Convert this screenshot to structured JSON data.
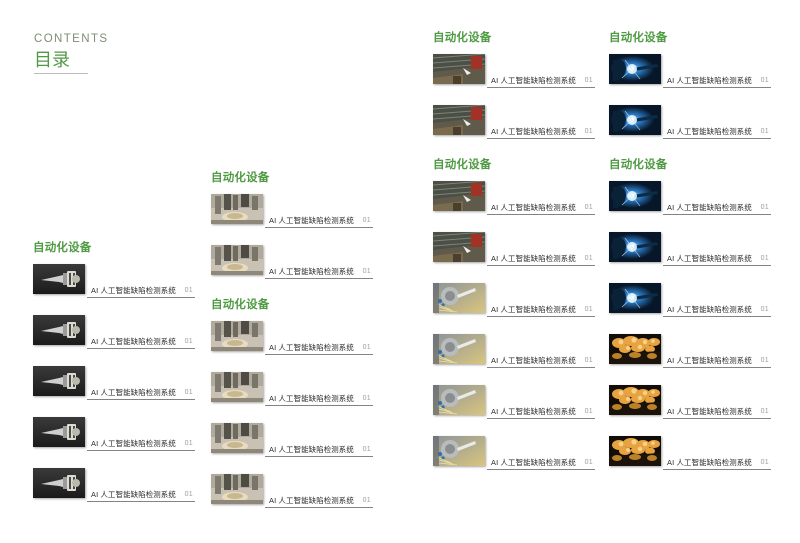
{
  "header": {
    "title_en": "CONTENTS",
    "title_cn": "目录",
    "accent_color": "#4f9a43",
    "title_en_color": "#7d8f75"
  },
  "entry_defaults": {
    "label": "AI 人工智能缺陷检测系统",
    "number": "01"
  },
  "columns": [
    {
      "name": "column-1",
      "sections": [
        {
          "title": "自动化设备",
          "thumb": "spindle",
          "items": [
            {
              "label": "AI 人工智能缺陷检测系统",
              "number": "01",
              "thumb": "spindle"
            },
            {
              "label": "AI 人工智能缺陷检测系统",
              "number": "01",
              "thumb": "spindle"
            },
            {
              "label": "AI 人工智能缺陷检测系统",
              "number": "01",
              "thumb": "spindle"
            },
            {
              "label": "AI 人工智能缺陷检测系统",
              "number": "01",
              "thumb": "spindle"
            },
            {
              "label": "AI 人工智能缺陷检测系统",
              "number": "01",
              "thumb": "spindle"
            }
          ]
        }
      ]
    },
    {
      "name": "column-2",
      "sections": [
        {
          "title": "自动化设备",
          "thumb": "machinery",
          "items": [
            {
              "label": "AI 人工智能缺陷检测系统",
              "number": "01",
              "thumb": "machinery"
            },
            {
              "label": "AI 人工智能缺陷检测系统",
              "number": "01",
              "thumb": "machinery"
            }
          ]
        },
        {
          "title": "自动化设备",
          "thumb": "machinery",
          "items": [
            {
              "label": "AI 人工智能缺陷检测系统",
              "number": "01",
              "thumb": "machinery"
            },
            {
              "label": "AI 人工智能缺陷检测系统",
              "number": "01",
              "thumb": "machinery"
            },
            {
              "label": "AI 人工智能缺陷检测系统",
              "number": "01",
              "thumb": "machinery"
            },
            {
              "label": "AI 人工智能缺陷检测系统",
              "number": "01",
              "thumb": "machinery"
            }
          ]
        }
      ]
    },
    {
      "name": "column-3",
      "sections": [
        {
          "title": "自动化设备",
          "thumb": "conveyor",
          "items": [
            {
              "label": "AI 人工智能缺陷检测系统",
              "number": "01",
              "thumb": "conveyor"
            },
            {
              "label": "AI 人工智能缺陷检测系统",
              "number": "01",
              "thumb": "conveyor"
            }
          ]
        },
        {
          "title": "自动化设备",
          "thumb": "conveyor",
          "items": [
            {
              "label": "AI 人工智能缺陷检测系统",
              "number": "01",
              "thumb": "conveyor"
            },
            {
              "label": "AI 人工智能缺陷检测系统",
              "number": "01",
              "thumb": "conveyor"
            },
            {
              "label": "AI 人工智能缺陷检测系统",
              "number": "01",
              "thumb": "sparks-silver"
            },
            {
              "label": "AI 人工智能缺陷检测系统",
              "number": "01",
              "thumb": "sparks-silver"
            },
            {
              "label": "AI 人工智能缺陷检测系统",
              "number": "01",
              "thumb": "sparks-silver"
            },
            {
              "label": "AI 人工智能缺陷检测系统",
              "number": "01",
              "thumb": "sparks-silver"
            }
          ]
        }
      ]
    },
    {
      "name": "column-4",
      "sections": [
        {
          "title": "自动化设备",
          "thumb": "welding-blue",
          "items": [
            {
              "label": "AI 人工智能缺陷检测系统",
              "number": "01",
              "thumb": "welding-blue"
            },
            {
              "label": "AI 人工智能缺陷检测系统",
              "number": "01",
              "thumb": "welding-blue"
            }
          ]
        },
        {
          "title": "自动化设备",
          "thumb": "welding-blue",
          "items": [
            {
              "label": "AI 人工智能缺陷检测系统",
              "number": "01",
              "thumb": "welding-blue"
            },
            {
              "label": "AI 人工智能缺陷检测系统",
              "number": "01",
              "thumb": "welding-blue"
            },
            {
              "label": "AI 人工智能缺陷检测系统",
              "number": "01",
              "thumb": "welding-blue"
            },
            {
              "label": "AI 人工智能缺陷检测系统",
              "number": "01",
              "thumb": "sparks-orange"
            },
            {
              "label": "AI 人工智能缺陷检测系统",
              "number": "01",
              "thumb": "sparks-orange"
            },
            {
              "label": "AI 人工智能缺陷检测系统",
              "number": "01",
              "thumb": "sparks-orange"
            }
          ]
        }
      ]
    }
  ]
}
